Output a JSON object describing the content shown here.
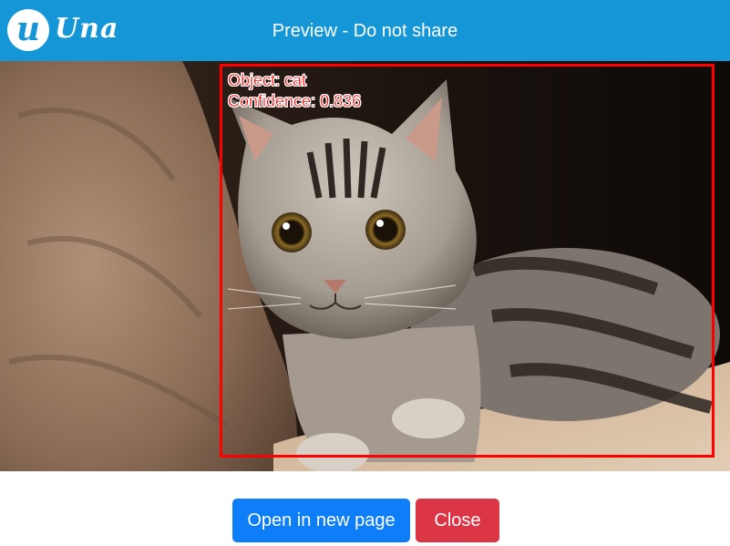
{
  "header": {
    "logo_letter": "u",
    "logo_word": "Una",
    "title": "Preview - Do not share",
    "background_color": "#1596d6"
  },
  "preview": {
    "image_subject": "cat",
    "detection": {
      "object_label": "Object: cat",
      "confidence_label": "Confidence: 0.836",
      "box_color": "#ff0000"
    }
  },
  "actions": {
    "open_label": "Open in new page",
    "close_label": "Close",
    "open_color": "#0d7ef8",
    "close_color": "#dc3545"
  }
}
